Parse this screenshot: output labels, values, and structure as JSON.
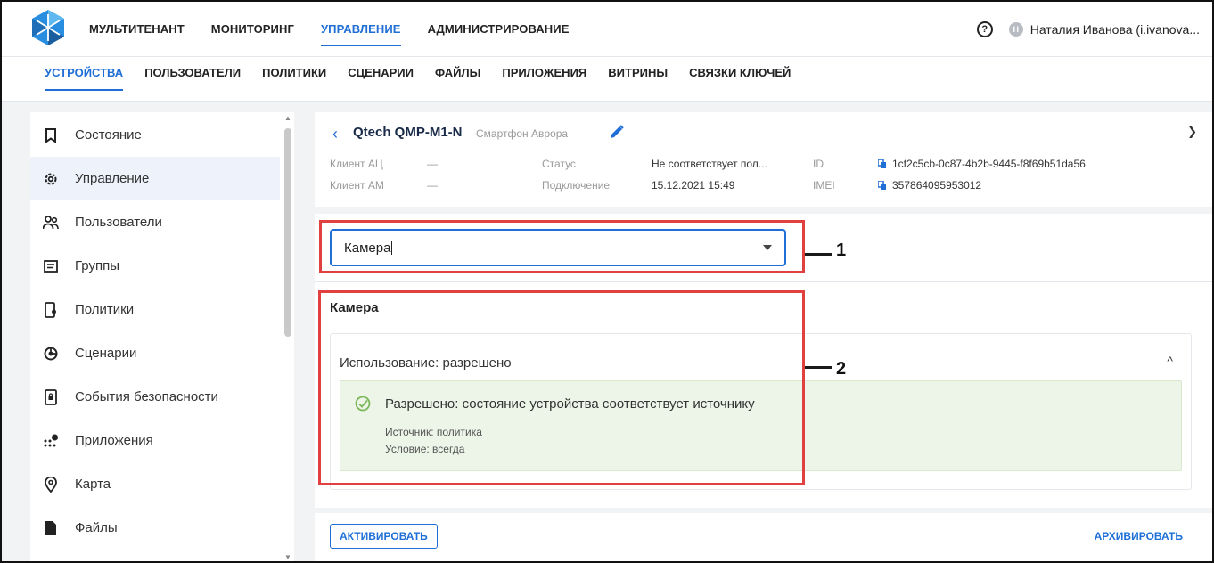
{
  "topnav": {
    "items": [
      "МУЛЬТИТЕНАНТ",
      "МОНИТОРИНГ",
      "УПРАВЛЕНИЕ",
      "АДМИНИСТРИРОВАНИЕ"
    ],
    "active": "УПРАВЛЕНИЕ",
    "user_initial": "Н",
    "user_name": "Наталия Иванова (i.ivanova..."
  },
  "subnav": {
    "items": [
      "УСТРОЙСТВА",
      "ПОЛЬЗОВАТЕЛИ",
      "ПОЛИТИКИ",
      "СЦЕНАРИИ",
      "ФАЙЛЫ",
      "ПРИЛОЖЕНИЯ",
      "ВИТРИНЫ",
      "СВЯЗКИ КЛЮЧЕЙ"
    ],
    "active": "УСТРОЙСТВА"
  },
  "sidebar": {
    "items": [
      {
        "label": "Состояние",
        "icon": "bookmark-icon"
      },
      {
        "label": "Управление",
        "icon": "gear-icon"
      },
      {
        "label": "Пользователи",
        "icon": "users-icon"
      },
      {
        "label": "Группы",
        "icon": "folder-icon"
      },
      {
        "label": "Политики",
        "icon": "policy-device-icon"
      },
      {
        "label": "Сценарии",
        "icon": "scenario-icon"
      },
      {
        "label": "События безопасности",
        "icon": "security-device-icon"
      },
      {
        "label": "Приложения",
        "icon": "apps-icon"
      },
      {
        "label": "Карта",
        "icon": "map-pin-icon"
      },
      {
        "label": "Файлы",
        "icon": "file-icon"
      }
    ],
    "active_index": 1
  },
  "device": {
    "name": "Qtech QMP-M1-N",
    "type": "Смартфон Аврора",
    "client_ac_label": "Клиент АЦ",
    "client_ac_value": "—",
    "client_am_label": "Клиент АМ",
    "client_am_value": "—",
    "status_label": "Статус",
    "status_value": "Не соответствует пол...",
    "connection_label": "Подключение",
    "connection_value": "15.12.2021 15:49",
    "id_label": "ID",
    "id_value": "1cf2c5cb-0c87-4b2b-9445-f8f69b51da56",
    "imei_label": "IMEI",
    "imei_value": "357864095953012"
  },
  "select": {
    "value": "Камера"
  },
  "section": {
    "title": "Камера",
    "usage": "Использование: разрешено",
    "result_title": "Разрешено: состояние устройства соответствует источнику",
    "source": "Источник: политика",
    "condition": "Условие: всегда"
  },
  "footer": {
    "activate_label": "АКТИВИРОВАТЬ",
    "archive_label": "АРХИВИРОВАТЬ"
  },
  "annotations": {
    "n1": "1",
    "n2": "2"
  },
  "colors": {
    "accent": "#1f6fd6",
    "annotation": "#e0403f",
    "success_bg": "#edf5e8"
  }
}
